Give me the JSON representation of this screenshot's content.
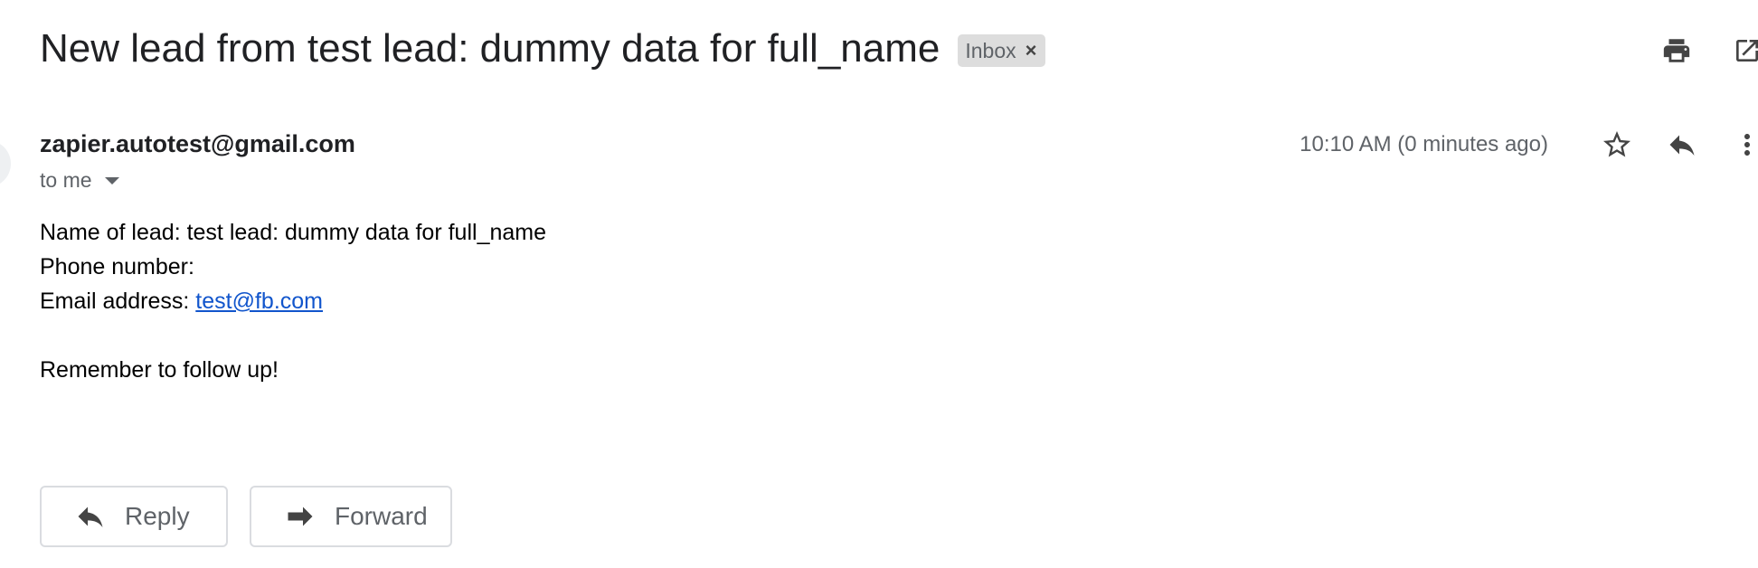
{
  "email": {
    "subject": "New lead from test lead: dummy data for full_name",
    "label": "Inbox",
    "label_remove": "×",
    "sender": "zapier.autotest@gmail.com",
    "recipient": "to me",
    "timestamp": "10:10 AM (0 minutes ago)"
  },
  "body": {
    "line1": "Name of lead: test lead: dummy data for full_name",
    "line2": "Phone number:",
    "line3_label": "Email address: ",
    "line3_link": "test@fb.com",
    "line4": "Remember to follow up!"
  },
  "actions": {
    "reply_label": "Reply",
    "forward_label": "Forward"
  },
  "icons": {
    "top": [
      "print-icon",
      "open-in-new-window-icon"
    ],
    "message": [
      "star-icon",
      "reply-icon",
      "more-vert-icon"
    ],
    "bottom": [
      "reply-icon",
      "forward-icon"
    ]
  },
  "colors": {
    "link": "#1155cc",
    "label_chip_bg": "#dddddd",
    "muted_text": "#5f6368",
    "icon": "#444444"
  }
}
